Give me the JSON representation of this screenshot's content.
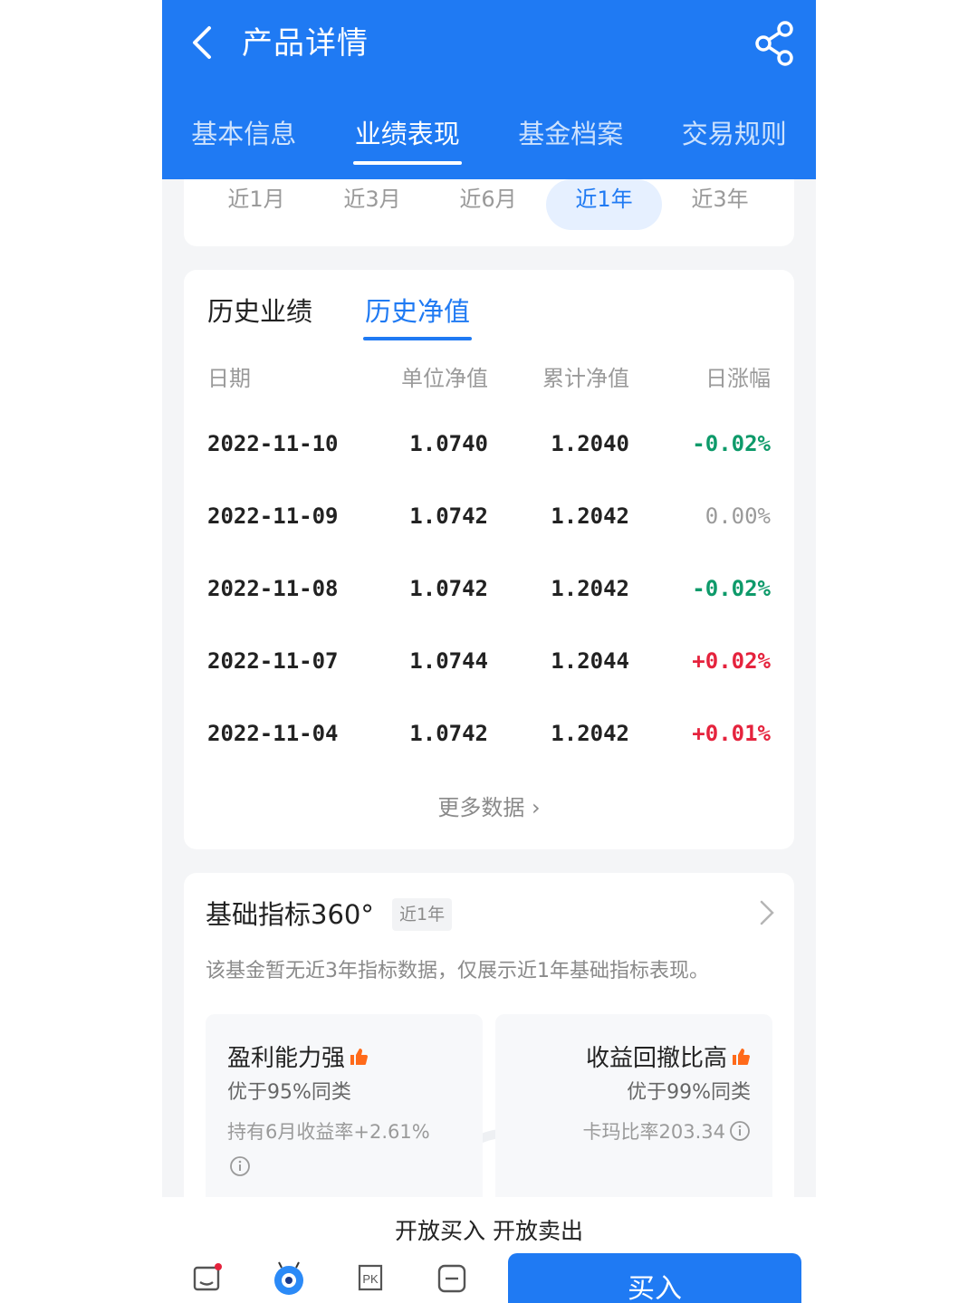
{
  "header": {
    "title": "产品详情",
    "tabs": [
      "基本信息",
      "业绩表现",
      "基金档案",
      "交易规则"
    ],
    "active_tab": 1
  },
  "periods": {
    "items": [
      "近1月",
      "近3月",
      "近6月",
      "近1年",
      "近3年"
    ],
    "active": 3
  },
  "history": {
    "tabs": [
      "历史业绩",
      "历史净值"
    ],
    "active_tab": 1,
    "columns": [
      "日期",
      "单位净值",
      "累计净值",
      "日涨幅"
    ],
    "rows": [
      {
        "date": "2022-11-10",
        "unit": "1.0740",
        "cum": "1.2040",
        "change": "-0.02%"
      },
      {
        "date": "2022-11-09",
        "unit": "1.0742",
        "cum": "1.2042",
        "change": "0.00%"
      },
      {
        "date": "2022-11-08",
        "unit": "1.0742",
        "cum": "1.2042",
        "change": "-0.02%"
      },
      {
        "date": "2022-11-07",
        "unit": "1.0744",
        "cum": "1.2044",
        "change": "+0.02%"
      },
      {
        "date": "2022-11-04",
        "unit": "1.0742",
        "cum": "1.2042",
        "change": "+0.01%"
      }
    ],
    "more": "更多数据 ›"
  },
  "indicators": {
    "title": "基础指标360°",
    "badge": "近1年",
    "desc": "该基金暂无近3年指标数据，仅展示近1年基础指标表现。",
    "left": {
      "title": "盈利能力强",
      "sub": "优于95%同类",
      "metric": "持有6月收益率+2.61%"
    },
    "right": {
      "title": "收益回撤比高",
      "sub": "优于99%同类",
      "metric": "卡玛比率203.34"
    }
  },
  "bottom": {
    "status": "开放买入 开放卖出",
    "buy_label": "买入"
  },
  "colors": {
    "primary": "#1f7af3",
    "positive": "#e5233d",
    "negative": "#0e9a6a",
    "thumb": "#ff6a1a"
  }
}
